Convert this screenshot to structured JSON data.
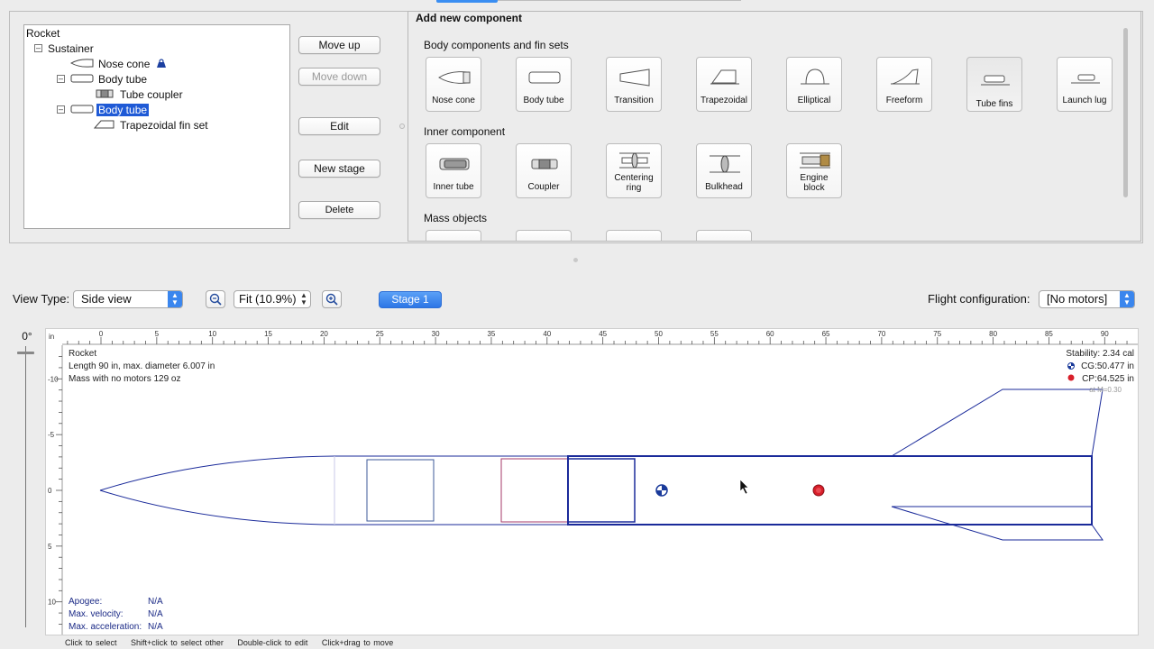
{
  "tree": {
    "root": "Rocket",
    "stage": "Sustainer",
    "items": [
      {
        "label": "Nose cone"
      },
      {
        "label": "Body tube"
      },
      {
        "label": "Tube coupler"
      },
      {
        "label": "Body tube"
      },
      {
        "label": "Trapezoidal fin set"
      }
    ]
  },
  "actions": {
    "move_up": "Move up",
    "move_down": "Move down",
    "edit": "Edit",
    "new_stage": "New stage",
    "delete": "Delete"
  },
  "add_component": {
    "title": "Add new component",
    "sections": [
      {
        "title": "Body components and fin sets",
        "items": [
          {
            "label": "Nose cone",
            "icon": "nose-cone-icon"
          },
          {
            "label": "Body tube",
            "icon": "body-tube-icon"
          },
          {
            "label": "Transition",
            "icon": "transition-icon"
          },
          {
            "label": "Trapezoidal",
            "icon": "trapezoidal-fin-icon"
          },
          {
            "label": "Elliptical",
            "icon": "elliptical-fin-icon"
          },
          {
            "label": "Freeform",
            "icon": "freeform-fin-icon"
          },
          {
            "label": "Tube fins",
            "icon": "tube-fins-icon"
          },
          {
            "label": "Launch lug",
            "icon": "launch-lug-icon"
          }
        ]
      },
      {
        "title": "Inner component",
        "items": [
          {
            "label": "Inner tube",
            "icon": "inner-tube-icon"
          },
          {
            "label": "Coupler",
            "icon": "coupler-icon"
          },
          {
            "label_lines": [
              "Centering",
              "ring"
            ],
            "icon": "centering-ring-icon"
          },
          {
            "label": "Bulkhead",
            "icon": "bulkhead-icon"
          },
          {
            "label_lines": [
              "Engine",
              "block"
            ],
            "icon": "engine-block-icon"
          }
        ]
      },
      {
        "title": "Mass objects"
      }
    ]
  },
  "view": {
    "view_type_label": "View Type:",
    "view_type_value": "Side view",
    "zoom_value": "Fit (10.9%)",
    "stage_button": "Stage 1",
    "flight_config_label": "Flight configuration:",
    "flight_config_value": "[No motors]",
    "angle": "0°"
  },
  "ruler": {
    "unit": "in",
    "ticks": [
      "0",
      "5",
      "10",
      "15",
      "20",
      "25",
      "30",
      "35",
      "40",
      "45",
      "50",
      "55",
      "60",
      "65",
      "70",
      "75",
      "80",
      "85",
      "90"
    ],
    "vertical_ticks": [
      "-10",
      "-5",
      "0",
      "5",
      "10"
    ]
  },
  "rocket_info": {
    "name": "Rocket",
    "length": "Length 90 in, max. diameter 6.007 in",
    "mass": "Mass with no motors 129 oz"
  },
  "stability": {
    "stability": "Stability:  2.34 cal",
    "cg": "CG:50.477 in",
    "cp": "CP:64.525 in",
    "mach": "at M=0.30"
  },
  "flight_data": {
    "apogee_label": "Apogee:",
    "apogee_value": "N/A",
    "velocity_label": "Max. velocity:",
    "velocity_value": "N/A",
    "accel_label": "Max. acceleration:",
    "accel_value": "N/A"
  },
  "status_bar": {
    "hint1": "Click to select",
    "hint2": "Shift+click to select other",
    "hint3": "Double-click to edit",
    "hint4": "Click+drag to move"
  }
}
